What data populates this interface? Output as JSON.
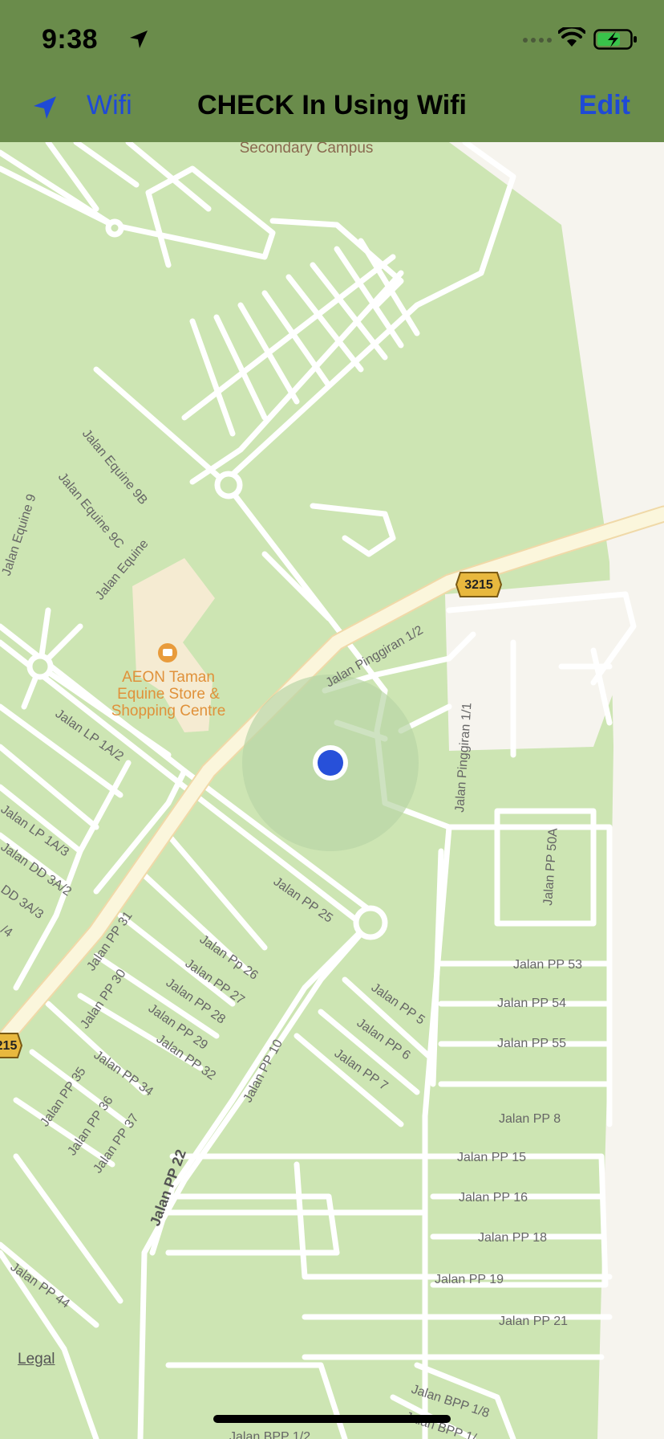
{
  "status_bar": {
    "time": "9:38"
  },
  "nav": {
    "back_label": "Wifi",
    "title": "CHECK In Using Wifi",
    "edit_label": "Edit"
  },
  "map": {
    "legal_label": "Legal",
    "poi": {
      "lines": [
        "AEON Taman",
        "Equine Store &",
        "Shopping Centre"
      ]
    },
    "secondary_label": "Secondary Campus",
    "route_shields": [
      "3215",
      "215"
    ],
    "street_labels": [
      "Jalan Equine 9",
      "Jalan Equine 9B",
      "Jalan Equine 9C",
      "Jalan Equine",
      "Jalan LP 1A/2",
      "Jalan LP 1A/3",
      "Jalan DD 3A/2",
      "DD 3A/3",
      "/4",
      "Jalan Pinggiran 1/2",
      "Jalan Pinggiran 1/1",
      "Jalan PP 50A",
      "Jalan PP 25",
      "Jalan PP 31",
      "Jalan PP 30",
      "Jalan Pp 26",
      "Jalan PP 27",
      "Jalan PP 28",
      "Jalan PP 29",
      "Jalan PP 32",
      "Jalan PP 34",
      "Jalan PP 35",
      "Jalan PP 36",
      "Jalan PP 37",
      "Jalan PP 10",
      "Jalan PP 22",
      "Jalan PP 5",
      "Jalan PP 6",
      "Jalan PP 7",
      "Jalan PP 53",
      "Jalan PP 54",
      "Jalan PP 55",
      "Jalan PP 8",
      "Jalan PP 15",
      "Jalan PP 16",
      "Jalan PP 18",
      "Jalan PP 19",
      "Jalan PP 21",
      "Jalan PP 44",
      "Jalan BPP 1/8",
      "Jalan BPP 1/",
      "Jalan BPP 1/2"
    ]
  },
  "colors": {
    "nav_bg": "#6a8c4b",
    "accent": "#1f4ad6",
    "park": "#cde5b3",
    "road": "#ffffff",
    "highway": "#fbf6dc",
    "user_dot": "#2750d9"
  }
}
